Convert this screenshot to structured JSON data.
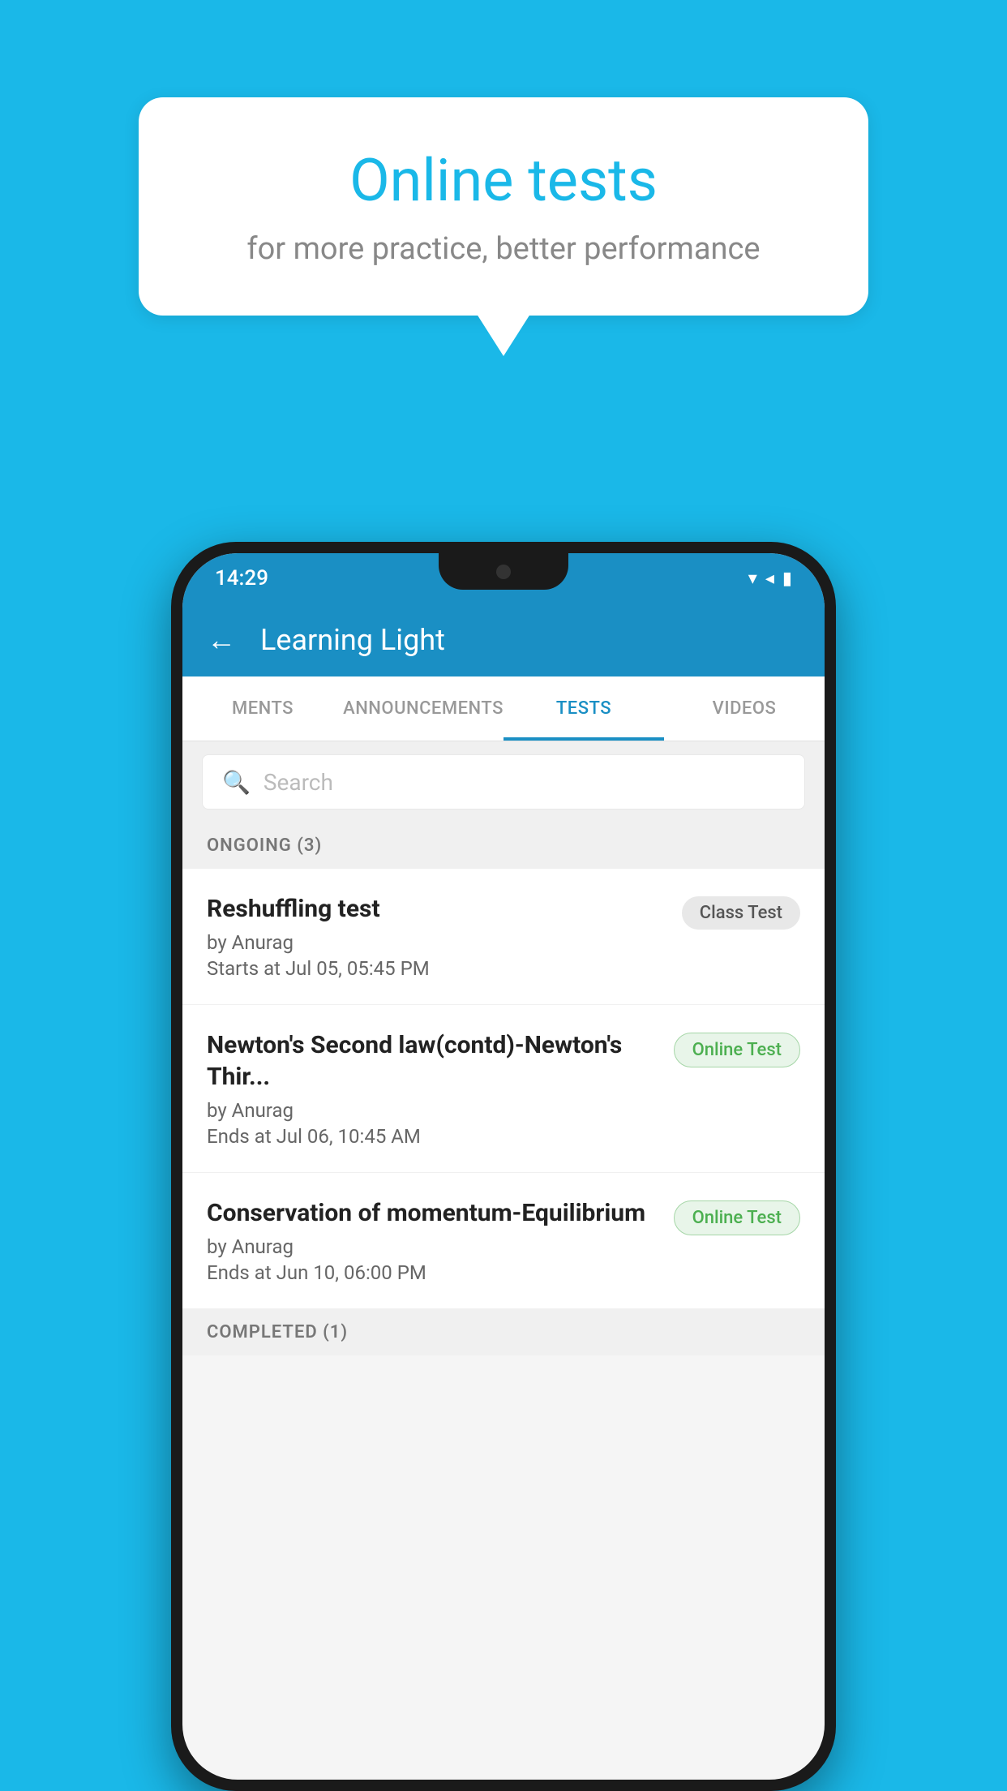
{
  "background": {
    "color": "#1ab8e8"
  },
  "speech_bubble": {
    "title": "Online tests",
    "subtitle": "for more practice, better performance"
  },
  "status_bar": {
    "time": "14:29"
  },
  "app_bar": {
    "back_label": "←",
    "title": "Learning Light"
  },
  "tabs": [
    {
      "id": "ments",
      "label": "MENTS",
      "active": false
    },
    {
      "id": "announcements",
      "label": "ANNOUNCEMENTS",
      "active": false
    },
    {
      "id": "tests",
      "label": "TESTS",
      "active": true
    },
    {
      "id": "videos",
      "label": "VIDEOS",
      "active": false
    }
  ],
  "search": {
    "placeholder": "Search"
  },
  "ongoing_section": {
    "label": "ONGOING (3)"
  },
  "tests": [
    {
      "id": 1,
      "name": "Reshuffling test",
      "author": "by Anurag",
      "time_label": "Starts at",
      "time_value": "Jul 05, 05:45 PM",
      "badge": "Class Test",
      "badge_type": "class"
    },
    {
      "id": 2,
      "name": "Newton's Second law(contd)-Newton's Thir...",
      "author": "by Anurag",
      "time_label": "Ends at",
      "time_value": "Jul 06, 10:45 AM",
      "badge": "Online Test",
      "badge_type": "online"
    },
    {
      "id": 3,
      "name": "Conservation of momentum-Equilibrium",
      "author": "by Anurag",
      "time_label": "Ends at",
      "time_value": "Jun 10, 06:00 PM",
      "badge": "Online Test",
      "badge_type": "online"
    }
  ],
  "completed_section": {
    "label": "COMPLETED (1)"
  }
}
